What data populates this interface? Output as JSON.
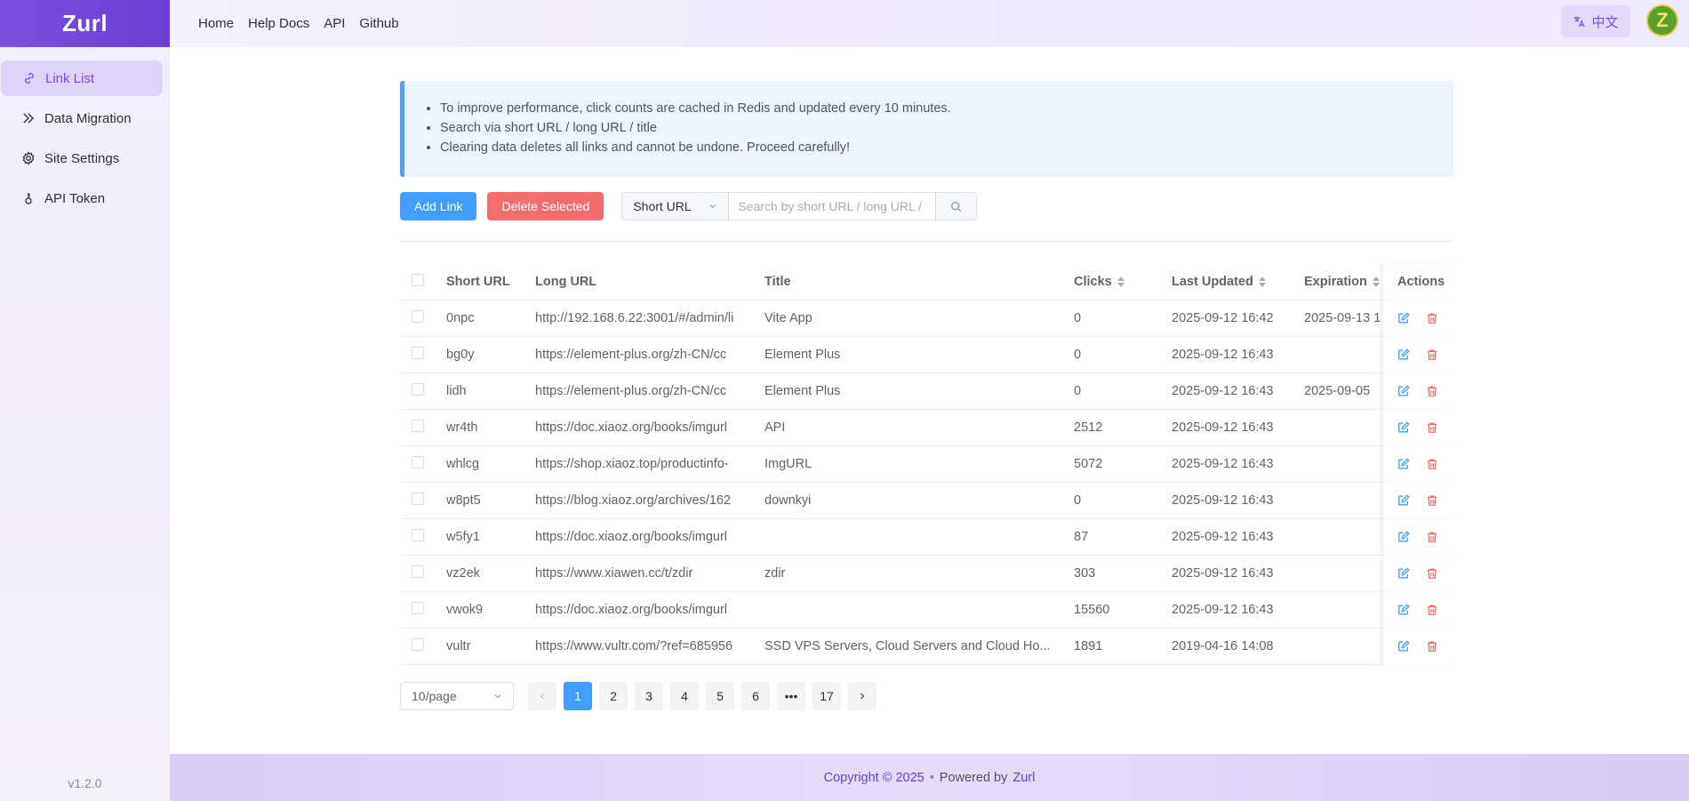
{
  "brand": "Zurl",
  "version": "v1.2.0",
  "sidebar": {
    "items": [
      {
        "label": "Link List",
        "icon": "link-icon",
        "active": true
      },
      {
        "label": "Data Migration",
        "icon": "double-chevron-icon"
      },
      {
        "label": "Site Settings",
        "icon": "gear-icon"
      },
      {
        "label": "API Token",
        "icon": "key-icon"
      }
    ]
  },
  "header": {
    "nav": [
      "Home",
      "Help Docs",
      "API",
      "Github"
    ],
    "lang_label": "中文",
    "avatar_letter": "Z"
  },
  "notice": [
    "To improve performance, click counts are cached in Redis and updated every 10 minutes.",
    "Search via short URL / long URL / title",
    "Clearing data deletes all links and cannot be undone. Proceed carefully!"
  ],
  "toolbar": {
    "add_label": "Add Link",
    "delete_label": "Delete Selected",
    "search_field": "Short URL",
    "search_placeholder": "Search by short URL / long URL / title"
  },
  "table": {
    "headers": {
      "short": "Short URL",
      "long": "Long URL",
      "title": "Title",
      "clicks": "Clicks",
      "updated": "Last Updated",
      "expiration": "Expiration",
      "actions": "Actions"
    },
    "rows": [
      {
        "short": "0npc",
        "long": "http://192.168.6.22:3001/#/admin/li",
        "title": "Vite App",
        "clicks": "0",
        "updated": "2025-09-12 16:42",
        "expiration": "2025-09-13 1"
      },
      {
        "short": "bg0y",
        "long": "https://element-plus.org/zh-CN/cc",
        "title": "Element Plus",
        "clicks": "0",
        "updated": "2025-09-12 16:43",
        "expiration": ""
      },
      {
        "short": "lidh",
        "long": "https://element-plus.org/zh-CN/cc",
        "title": "Element Plus",
        "clicks": "0",
        "updated": "2025-09-12 16:43",
        "expiration": "2025-09-05"
      },
      {
        "short": "wr4th",
        "long": "https://doc.xiaoz.org/books/imgurl",
        "title": "API",
        "clicks": "2512",
        "updated": "2025-09-12 16:43",
        "expiration": ""
      },
      {
        "short": "whlcg",
        "long": "https://shop.xiaoz.top/productinfo-",
        "title": "ImgURL",
        "clicks": "5072",
        "updated": "2025-09-12 16:43",
        "expiration": ""
      },
      {
        "short": "w8pt5",
        "long": "https://blog.xiaoz.org/archives/162",
        "title": "downkyi",
        "clicks": "0",
        "updated": "2025-09-12 16:43",
        "expiration": ""
      },
      {
        "short": "w5fy1",
        "long": "https://doc.xiaoz.org/books/imgurl",
        "title": "",
        "clicks": "87",
        "updated": "2025-09-12 16:43",
        "expiration": ""
      },
      {
        "short": "vz2ek",
        "long": "https://www.xiawen.cc/t/zdir",
        "title": "zdir",
        "clicks": "303",
        "updated": "2025-09-12 16:43",
        "expiration": ""
      },
      {
        "short": "vwok9",
        "long": "https://doc.xiaoz.org/books/imgurl",
        "title": "",
        "clicks": "15560",
        "updated": "2025-09-12 16:43",
        "expiration": ""
      },
      {
        "short": "vultr",
        "long": "https://www.vultr.com/?ref=685956",
        "title": "SSD VPS Servers, Cloud Servers and Cloud Ho...",
        "clicks": "1891",
        "updated": "2019-04-16 14:08",
        "expiration": ""
      }
    ]
  },
  "pagination": {
    "page_size": "10/page",
    "pages": [
      "1",
      "2",
      "3",
      "4",
      "5",
      "6",
      "•••",
      "17"
    ],
    "current": "1"
  },
  "footer": {
    "copyright": "Copyright © 2025",
    "powered_by": "Powered by",
    "link": "Zurl"
  },
  "colors": {
    "brand": "#7a50de",
    "primary": "#409eff",
    "danger": "#f56c6c"
  }
}
